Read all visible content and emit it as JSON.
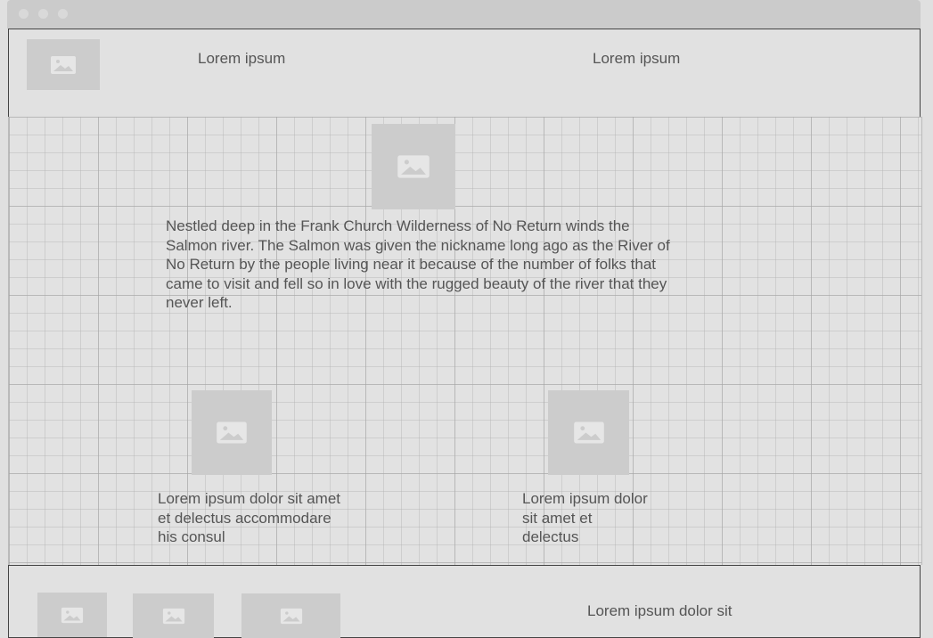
{
  "header": {
    "logo_icon": "image-icon",
    "nav_items": [
      {
        "label": "Lorem ipsum"
      },
      {
        "label": "Lorem ipsum"
      }
    ]
  },
  "hero": {
    "image_icon": "image-icon",
    "paragraph": "Nestled deep in the Frank Church Wilderness of No Return winds the Salmon river. The Salmon was given the nickname long ago as the River of No Return by the people living near it because of the number of folks that came to visit and fell so in love with the rugged beauty of the river that they never left."
  },
  "features": [
    {
      "image_icon": "image-icon",
      "caption": "Lorem ipsum dolor sit amet et delectus accommodare his consul"
    },
    {
      "image_icon": "image-icon",
      "caption": "Lorem ipsum dolor sit amet et delectus"
    }
  ],
  "footer": {
    "thumbnails": [
      "image-icon",
      "image-icon",
      "image-icon"
    ],
    "text": "Lorem ipsum dolor sit"
  },
  "colors": {
    "background": "#e0e0e0",
    "placeholder": "#cccccc",
    "text": "#555555",
    "border": "#444444"
  }
}
